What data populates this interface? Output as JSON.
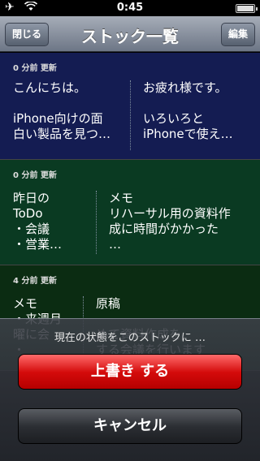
{
  "status_bar": {
    "time": "0:45",
    "airplane_icon": "airplane-icon",
    "wifi_icon": "wifi-icon"
  },
  "nav": {
    "close_label": "閉じる",
    "title": "ストック一覧",
    "edit_label": "編集"
  },
  "stocks": [
    {
      "updated": "0 分前 更新",
      "left": "こんにちは。\n\niPhone向けの面\n白い製品を見つ…",
      "right": "お疲れ様です。\n\nいろいろと\niPhoneで使え…"
    },
    {
      "updated": "0 分前 更新",
      "left": "昨日の\nToDo\n・会議\n・営業…",
      "right": "メモ\nリハーサル用の資料作\n成に時間がかかった\n…"
    },
    {
      "updated": "4 分前 更新",
      "left": "メモ\n・来週月\n曜に会\n・ ",
      "right": "原稿\n\nめて資料作成を\nする会議を行います"
    }
  ],
  "sheet": {
    "title": "現在の状態をこのストックに …",
    "overwrite_label": "上書き する",
    "cancel_label": "キャンセル"
  }
}
